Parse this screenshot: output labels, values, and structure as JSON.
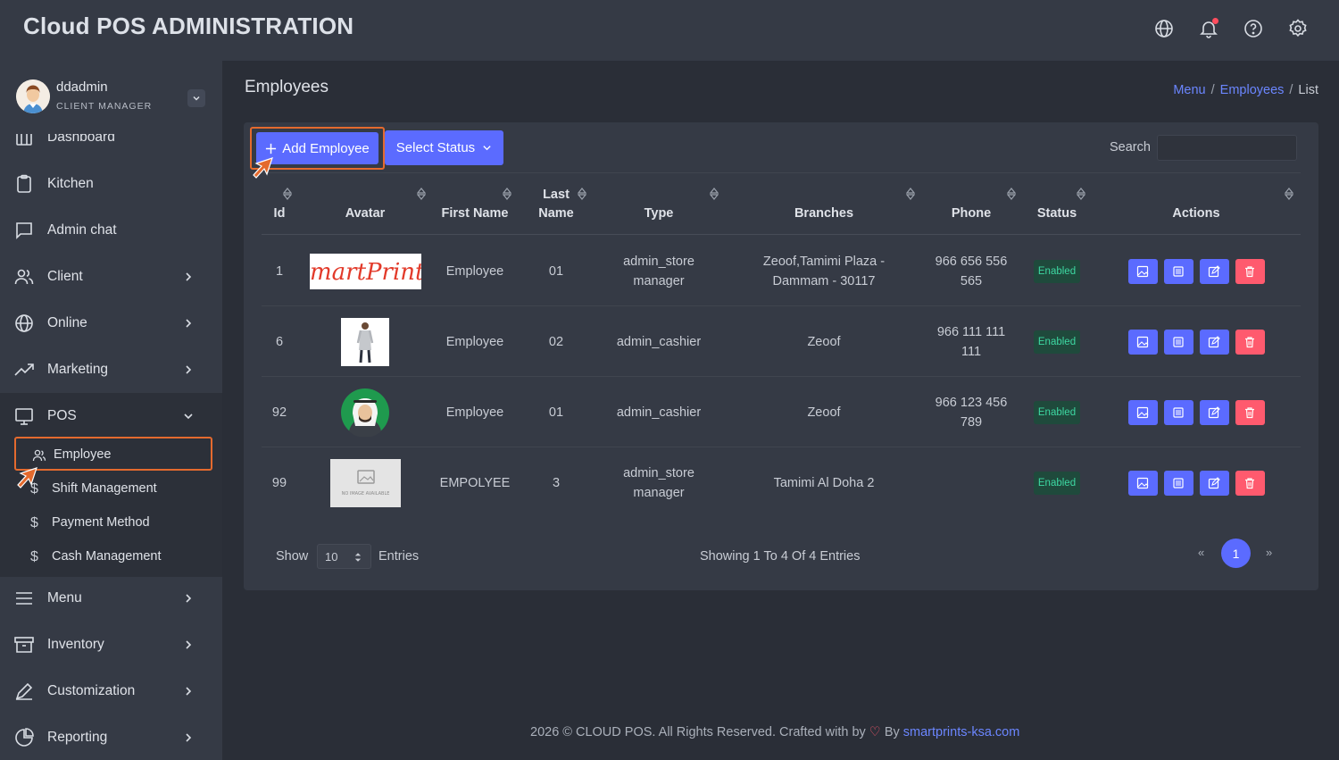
{
  "header": {
    "brand": "Cloud POS ADMINISTRATION",
    "icons": [
      "globe-icon",
      "bell-icon",
      "help-icon",
      "gear-icon"
    ]
  },
  "user": {
    "name": "ddadmin",
    "role": "CLIENT MANAGER"
  },
  "sidebar": {
    "items": [
      {
        "label": "Dashboard",
        "icon": "dashboard-icon"
      },
      {
        "label": "Kitchen",
        "icon": "clipboard-icon"
      },
      {
        "label": "Admin chat",
        "icon": "chat-icon"
      },
      {
        "label": "Client",
        "icon": "users-icon"
      },
      {
        "label": "Online",
        "icon": "globe-icon"
      },
      {
        "label": "Marketing",
        "icon": "trend-icon"
      },
      {
        "label": "POS",
        "icon": "monitor-icon"
      },
      {
        "label": "Menu",
        "icon": "menu-icon"
      },
      {
        "label": "Inventory",
        "icon": "archive-icon"
      },
      {
        "label": "Customization",
        "icon": "pen-icon"
      },
      {
        "label": "Reporting",
        "icon": "pie-icon"
      }
    ],
    "pos_sub": [
      {
        "label": "Employee",
        "icon": "user-icon"
      },
      {
        "label": "Shift Management",
        "icon": "dollar-icon"
      },
      {
        "label": "Payment Method",
        "icon": "dollar-icon"
      },
      {
        "label": "Cash Management",
        "icon": "dollar-icon"
      }
    ]
  },
  "page": {
    "title": "Employees",
    "breadcrumb": [
      "Menu",
      "Employees",
      "List"
    ]
  },
  "toolbar": {
    "add_label": "Add Employee",
    "status_label": "Select Status",
    "search_label": "Search",
    "search_value": ""
  },
  "table": {
    "columns": [
      "Id",
      "Avatar",
      "First Name",
      "Last Name",
      "Type",
      "Branches",
      "Phone",
      "Status",
      "Actions"
    ],
    "rows": [
      {
        "id": "1",
        "avatar": "smartprints-logo",
        "first": "Employee",
        "last": "01",
        "type": "admin_store manager",
        "branches": "Zeoof,Tamimi Plaza - Dammam - 30117",
        "phone": "966 656 556 565",
        "status": "Enabled"
      },
      {
        "id": "6",
        "avatar": "person-photo",
        "first": "Employee",
        "last": "02",
        "type": "admin_cashier",
        "branches": "Zeoof",
        "phone": "966 111 111 111",
        "status": "Enabled"
      },
      {
        "id": "92",
        "avatar": "arab-avatar",
        "first": "Employee",
        "last": "01",
        "type": "admin_cashier",
        "branches": "Zeoof",
        "phone": "966 123 456 789",
        "status": "Enabled"
      },
      {
        "id": "99",
        "avatar": "no-image",
        "first": "EMPOLYEE",
        "last": "3",
        "type": "admin_store manager",
        "branches": "Tamimi Al Doha 2",
        "phone": "",
        "status": "Enabled"
      }
    ],
    "no_image_text": "NO IMAGE AVAILABLE",
    "logo_text": "SmartPrints"
  },
  "pagination": {
    "show_label": "Show",
    "page_size": "10",
    "entries_label": "Entries",
    "showing_text": "Showing 1 To 4 Of 4 Entries",
    "prev": "«",
    "current": "1",
    "next": "»"
  },
  "footer": {
    "text": "2026 © CLOUD POS. All Rights Reserved. Crafted with by",
    "by": "By",
    "link": "smartprints-ksa.com"
  },
  "colors": {
    "accent": "#5b6bff",
    "danger": "#ff5a6e",
    "highlight": "#e46a2e",
    "success": "#3dd8a2"
  }
}
